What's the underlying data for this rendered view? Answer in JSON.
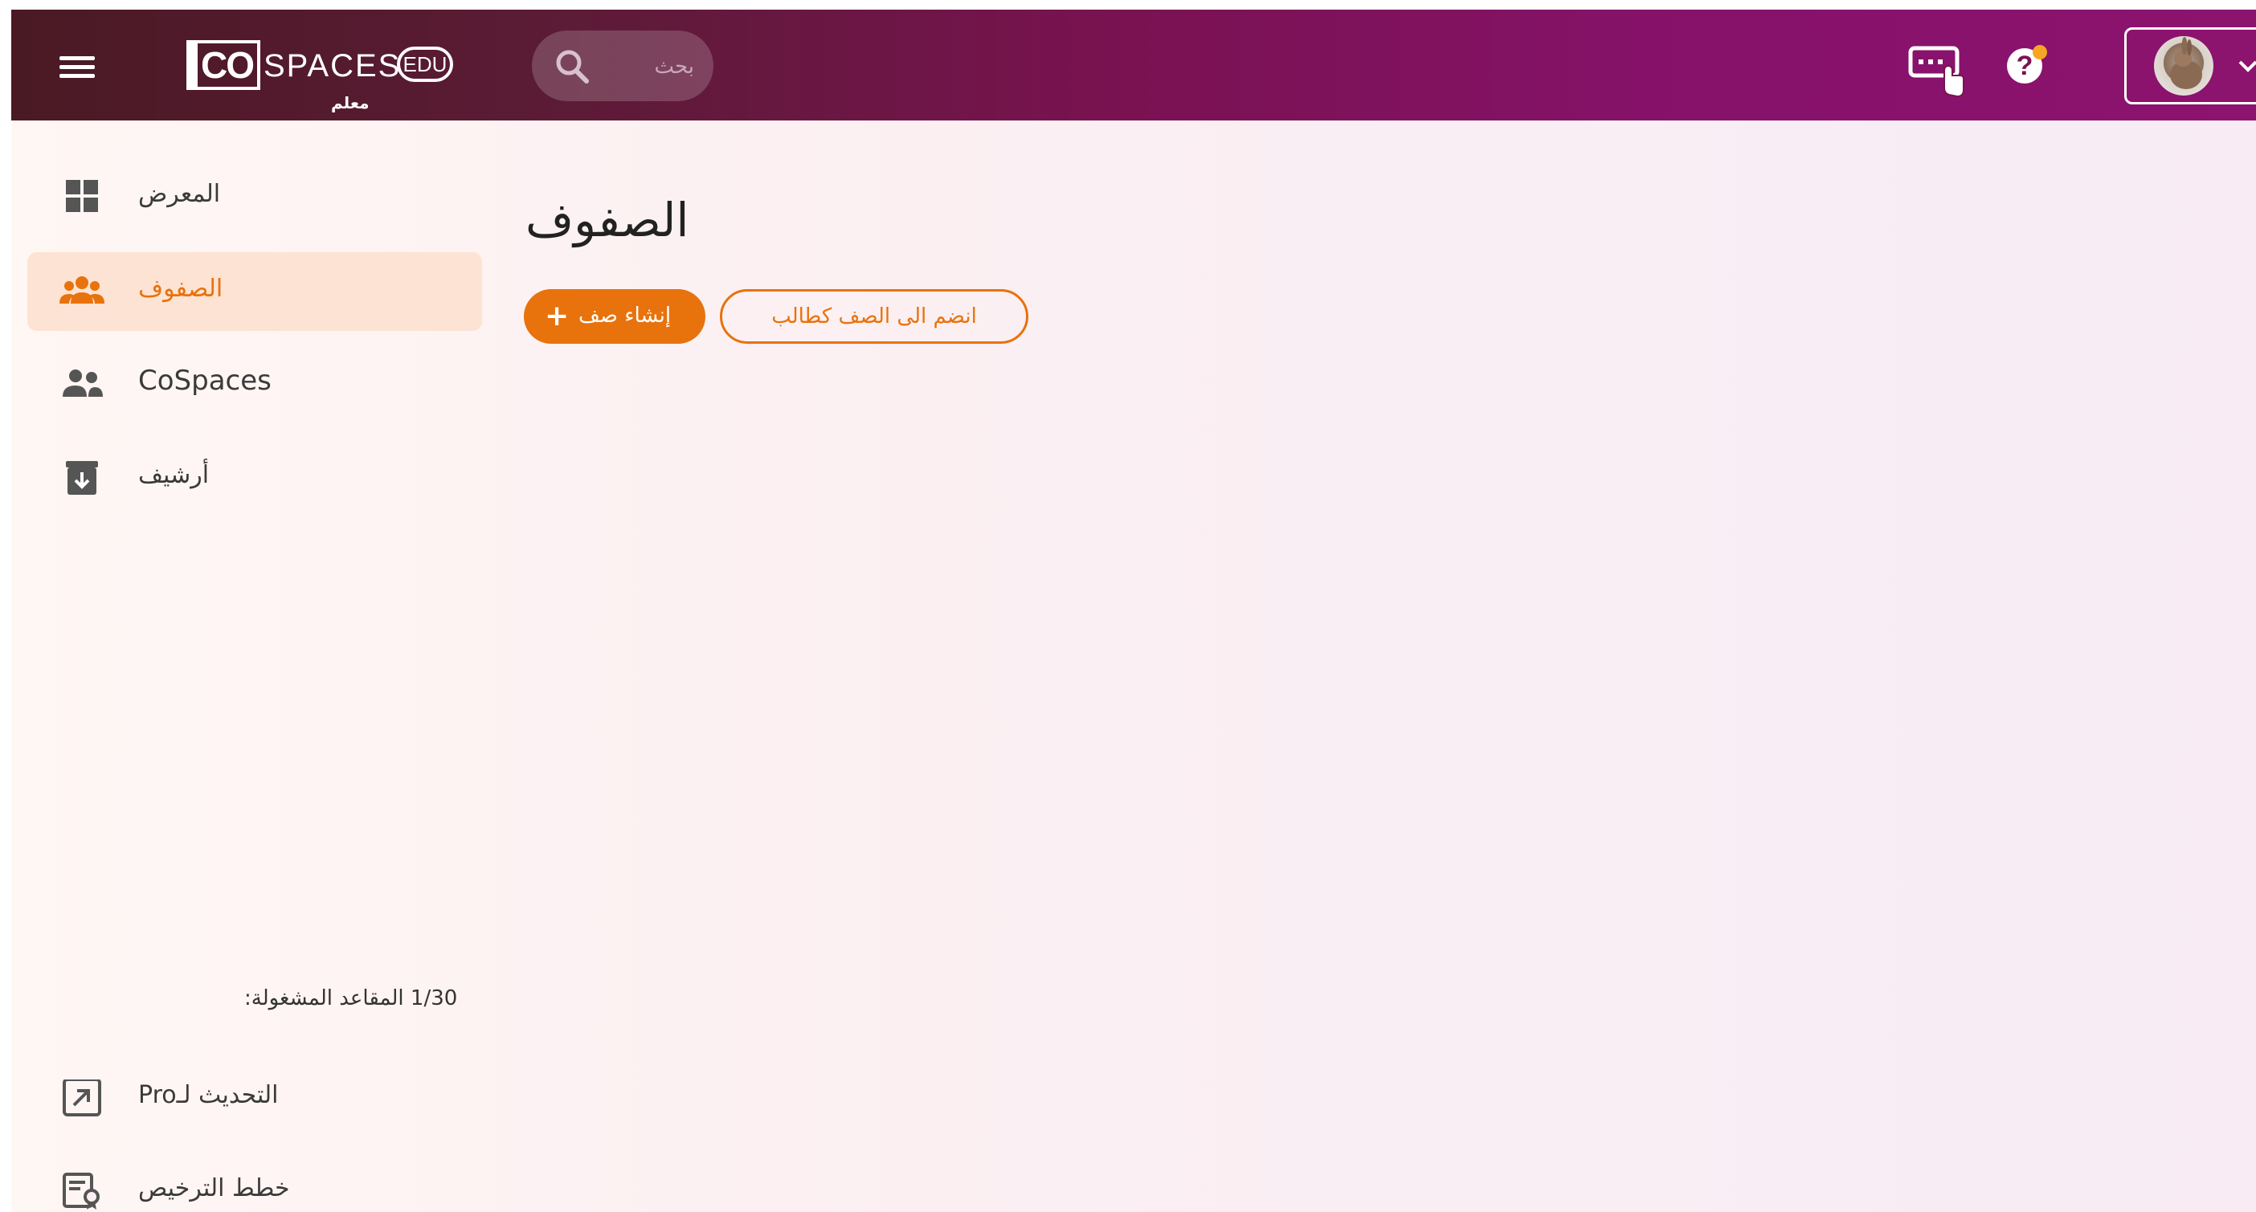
{
  "header": {
    "logo_brand": "CoSPACES EDU",
    "logo_co": "CO",
    "logo_spaces": "SPACES",
    "logo_edu": "EDU",
    "role_label": "معلم",
    "search_placeholder": "بحث",
    "menu_icon": "hamburger-menu-icon",
    "keyboard_icon": "keyboard-shortcuts-icon",
    "help_icon": "help-icon",
    "notification_color": "#f5a623"
  },
  "sidebar": {
    "items": [
      {
        "label": "المعرض",
        "icon": "gallery-grid-icon"
      },
      {
        "label": "الصفوف",
        "icon": "classes-people-icon",
        "active": true
      },
      {
        "label": "CoSpaces",
        "icon": "cospaces-people-icon"
      },
      {
        "label": "أرشيف",
        "icon": "archive-icon"
      }
    ],
    "seats_text": "1/30 المقاعد المشغولة:",
    "bottom_items": [
      {
        "label": "التحديث لـPro",
        "icon": "upgrade-arrow-icon"
      },
      {
        "label": "خطط الترخيص",
        "icon": "license-plans-icon"
      }
    ]
  },
  "main": {
    "title": "الصفوف",
    "create_class_button": "إنشاء صف",
    "join_class_button": "انضم الى الصف كطالب"
  },
  "colors": {
    "accent": "#e8720c",
    "active_bg": "#fde3d3",
    "header_start": "#4a1a24",
    "header_end": "#8c136e"
  }
}
